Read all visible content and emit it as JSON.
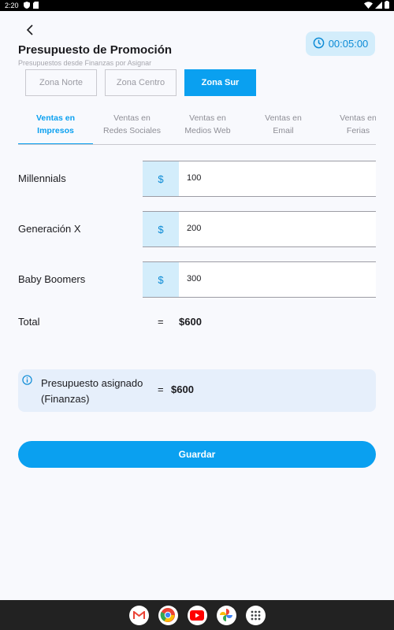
{
  "status_bar": {
    "time": "2:20"
  },
  "header": {
    "title": "Presupuesto de Promoción",
    "subtitle": "Presupuestos desde Finanzas por Asignar",
    "timer": "00:05:00"
  },
  "zones": [
    {
      "label": "Zona Norte",
      "active": false
    },
    {
      "label": "Zona Centro",
      "active": false
    },
    {
      "label": "Zona Sur",
      "active": true
    }
  ],
  "tabs": [
    {
      "line1": "Ventas en",
      "line2": "Impresos",
      "active": true
    },
    {
      "line1": "Ventas en",
      "line2": "Redes Sociales",
      "active": false
    },
    {
      "line1": "Ventas en",
      "line2": "Medios Web",
      "active": false
    },
    {
      "line1": "Ventas en",
      "line2": "Email",
      "active": false
    },
    {
      "line1": "Ventas en",
      "line2": "Ferias",
      "active": false
    }
  ],
  "rows": [
    {
      "label": "Millennials",
      "currency": "$",
      "value": "100"
    },
    {
      "label": "Generación X",
      "currency": "$",
      "value": "200"
    },
    {
      "label": "Baby Boomers",
      "currency": "$",
      "value": "300"
    }
  ],
  "total": {
    "label": "Total",
    "eq": "=",
    "value": "$600"
  },
  "info": {
    "label": "Presupuesto asignado (Finanzas)",
    "eq": "=",
    "value": "$600"
  },
  "save_label": "Guardar",
  "colors": {
    "accent": "#0aa0f0",
    "accent_light": "#d3edfb",
    "info_bg": "#e6effb"
  },
  "nav_apps": [
    "gmail-icon",
    "chrome-icon",
    "youtube-icon",
    "photos-icon",
    "app-drawer-icon"
  ]
}
